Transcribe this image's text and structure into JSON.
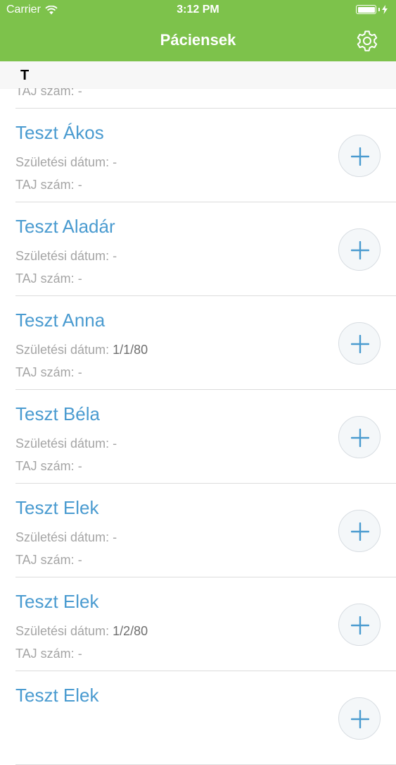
{
  "status_bar": {
    "carrier": "Carrier",
    "time": "3:12 PM"
  },
  "nav": {
    "title": "Páciensek",
    "settings_icon": "gear-icon"
  },
  "section": {
    "letter": "T"
  },
  "labels": {
    "birth": "Születési dátum:",
    "taj": "TAJ szám:"
  },
  "partial_row": {
    "taj_value": "-"
  },
  "patients": [
    {
      "name": "Teszt Ákos",
      "birth": "-",
      "taj": "-"
    },
    {
      "name": "Teszt Aladár",
      "birth": "-",
      "taj": "-"
    },
    {
      "name": "Teszt Anna",
      "birth": "1/1/80",
      "taj": "-"
    },
    {
      "name": "Teszt Béla",
      "birth": "-",
      "taj": "-"
    },
    {
      "name": "Teszt Elek",
      "birth": "-",
      "taj": "-"
    },
    {
      "name": "Teszt Elek",
      "birth": "1/2/80",
      "taj": "-"
    },
    {
      "name": "Teszt Elek",
      "birth": "",
      "taj": ""
    }
  ],
  "colors": {
    "accent": "#7dc24b",
    "name": "#4a9bd0",
    "secondary_text": "#a5a5a5"
  }
}
